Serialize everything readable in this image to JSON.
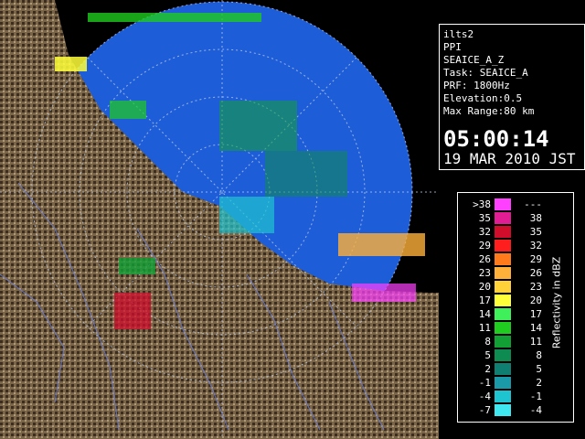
{
  "info": {
    "site": "ilts2",
    "product": "PPI",
    "task": "SEAICE_A_Z",
    "task_line": "Task: SEAICE_A",
    "prf": "PRF: 1800Hz",
    "elevation": "Elevation:0.5",
    "max_range": "Max Range:80 km",
    "time": "05:00:14",
    "date": "19 MAR 2010 JST"
  },
  "legend": {
    "title": "Reflectivity in dBZ",
    "rows": [
      {
        "lo": ">38",
        "hi": "---",
        "color": "#ff40ff"
      },
      {
        "lo": "35",
        "hi": "38",
        "color": "#e01d93"
      },
      {
        "lo": "32",
        "hi": "35",
        "color": "#d10d2c"
      },
      {
        "lo": "29",
        "hi": "32",
        "color": "#ff1e1e"
      },
      {
        "lo": "26",
        "hi": "29",
        "color": "#ff7a1a"
      },
      {
        "lo": "23",
        "hi": "26",
        "color": "#ffb03a"
      },
      {
        "lo": "20",
        "hi": "23",
        "color": "#ffd23a"
      },
      {
        "lo": "17",
        "hi": "20",
        "color": "#ffff3a"
      },
      {
        "lo": "14",
        "hi": "17",
        "color": "#3ff05a"
      },
      {
        "lo": "11",
        "hi": "14",
        "color": "#1fcc1f"
      },
      {
        "lo": "8",
        "hi": "11",
        "color": "#12a035"
      },
      {
        "lo": "5",
        "hi": "8",
        "color": "#0e8b51"
      },
      {
        "lo": "2",
        "hi": "5",
        "color": "#0f7f72"
      },
      {
        "lo": "-1",
        "hi": "2",
        "color": "#1a9aa8"
      },
      {
        "lo": "-4",
        "hi": "-1",
        "color": "#1ec4cf"
      },
      {
        "lo": "-7",
        "hi": "-4",
        "color": "#3fe8f0"
      }
    ]
  },
  "colors": {
    "sea": "#1e5dd8",
    "land": "#7a6548",
    "range_ring": "#b7c9ea"
  }
}
